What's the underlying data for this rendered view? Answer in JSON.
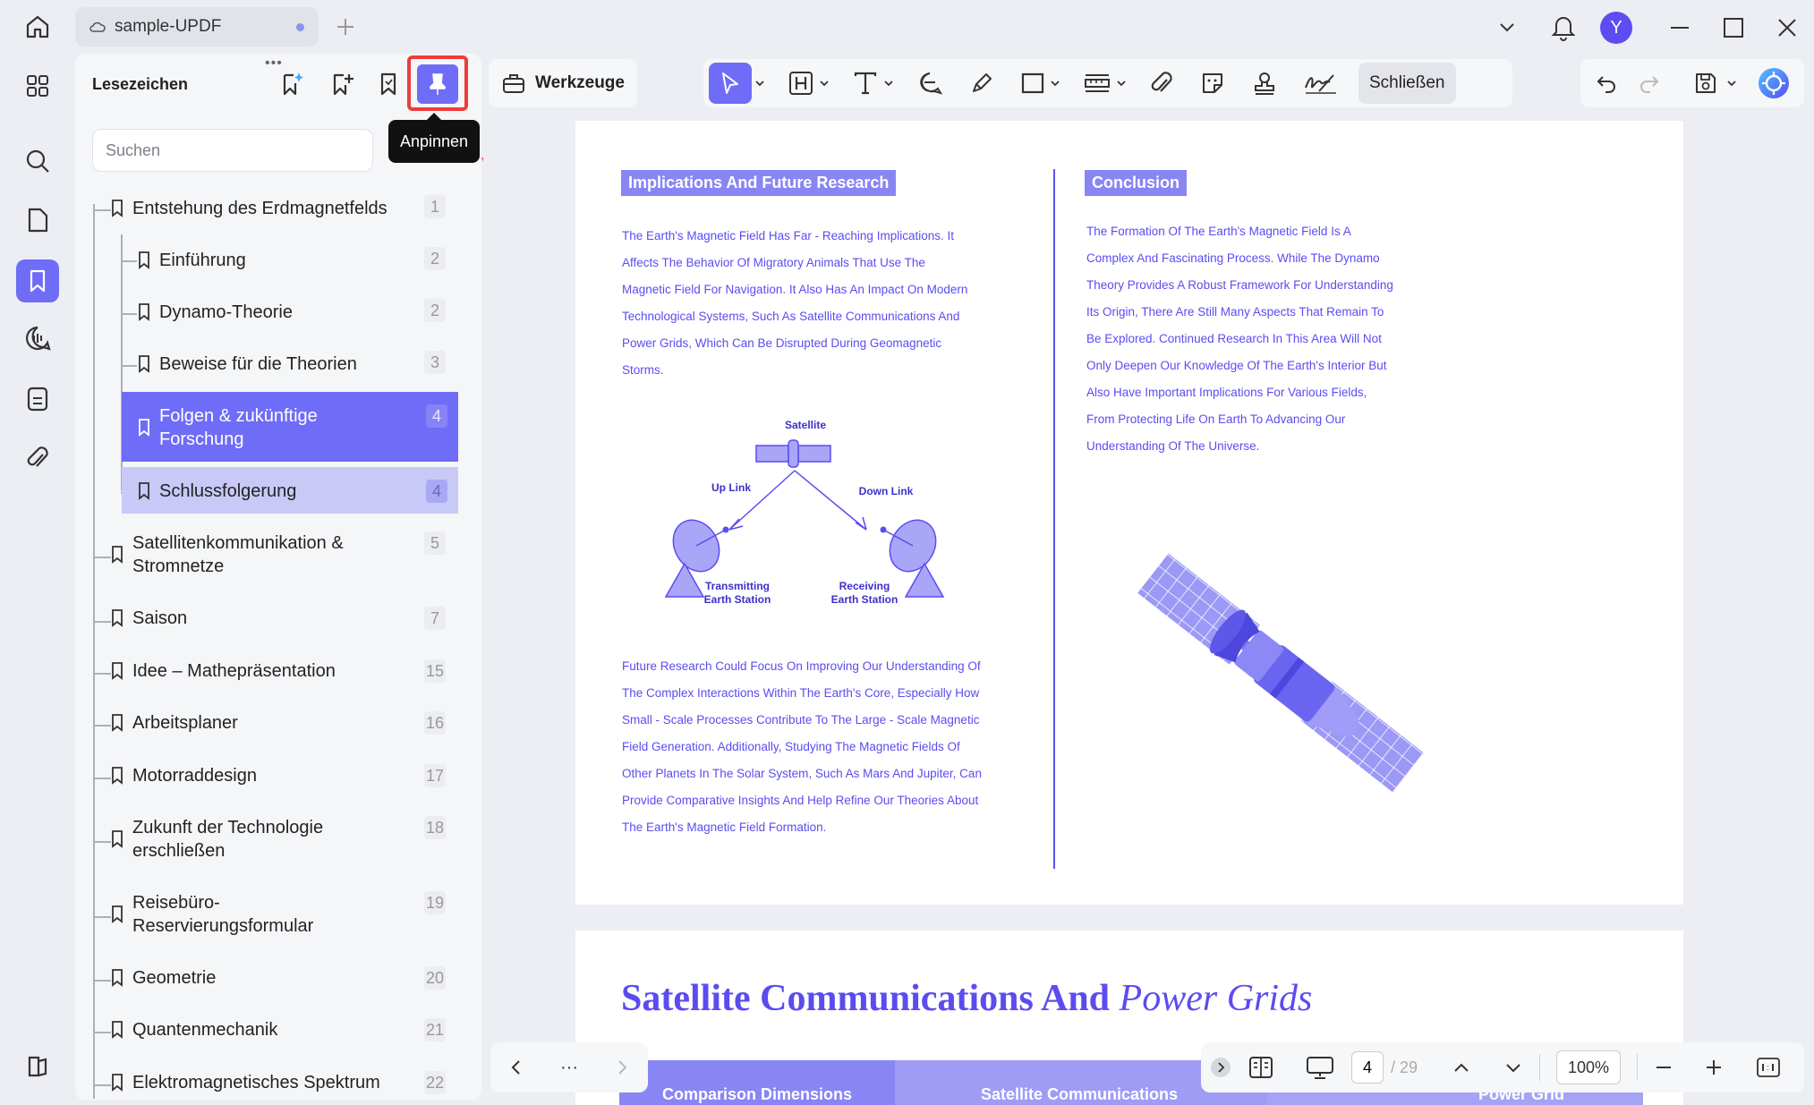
{
  "window": {
    "tab_title": "sample-UPDF",
    "avatar_letter": "Y"
  },
  "panel": {
    "title": "Lesezeichen",
    "pin_tooltip": "Anpinnen",
    "search_placeholder": "Suchen",
    "bookmarks": [
      {
        "label": "Entstehung des Erdmagnetfelds",
        "page": "1",
        "level": 0
      },
      {
        "label": "Einführung",
        "page": "2",
        "level": 1
      },
      {
        "label": "Dynamo-Theorie",
        "page": "2",
        "level": 1
      },
      {
        "label": "Beweise für die Theorien",
        "page": "3",
        "level": 1
      },
      {
        "label": "Folgen & zukünftige Forschung",
        "page": "4",
        "level": 1,
        "state": "selected"
      },
      {
        "label": "Schlussfolgerung",
        "page": "4",
        "level": 1,
        "state": "highlighted"
      },
      {
        "label": "Satellitenkommunikation & Stromnetze",
        "page": "5",
        "level": 0
      },
      {
        "label": "Saison",
        "page": "7",
        "level": 0
      },
      {
        "label": "Idee – Mathepräsentation",
        "page": "15",
        "level": 0
      },
      {
        "label": "Arbeitsplaner",
        "page": "16",
        "level": 0
      },
      {
        "label": "Motorraddesign",
        "page": "17",
        "level": 0
      },
      {
        "label": "Zukunft der Technologie erschließen",
        "page": "18",
        "level": 0
      },
      {
        "label": "Reisebüro-Reservierungsformular",
        "page": "19",
        "level": 0
      },
      {
        "label": "Geometrie",
        "page": "20",
        "level": 0
      },
      {
        "label": "Quantenmechanik",
        "page": "21",
        "level": 0
      },
      {
        "label": "Elektromagnetisches Spektrum",
        "page": "22",
        "level": 0
      }
    ]
  },
  "toolbar": {
    "tools_label": "Werkzeuge",
    "close_label": "Schließen"
  },
  "document": {
    "left_heading": "Implications And Future Research",
    "left_para_1": [
      "The Earth's Magnetic Field Has Far - Reaching Implications. It",
      "Affects The Behavior Of Migratory Animals That Use The",
      "Magnetic Field For Navigation. It Also Has An Impact On Modern",
      "Technological Systems, Such As Satellite Communications And",
      "Power Grids, Which Can Be Disrupted During Geomagnetic",
      "Storms."
    ],
    "diagram": {
      "satellite": "Satellite",
      "up_link": "Up Link",
      "down_link": "Down Link",
      "transmitting_1": "Transmitting",
      "transmitting_2": "Earth Station",
      "receiving_1": "Receiving",
      "receiving_2": "Earth Station"
    },
    "left_para_2": [
      "Future Research Could Focus On Improving Our Understanding Of",
      "The Complex Interactions Within The Earth's Core, Especially How",
      "Small - Scale Processes Contribute To The Large - Scale Magnetic",
      "Field Generation. Additionally, Studying The Magnetic Fields Of",
      "Other Planets In The Solar System, Such As Mars And Jupiter, Can",
      "Provide Comparative Insights And Help Refine Our Theories About",
      "The Earth's Magnetic Field Formation."
    ],
    "right_heading": "Conclusion",
    "right_para": [
      "The Formation Of The Earth's Magnetic Field Is A",
      "Complex And Fascinating Process. While The Dynamo",
      "Theory Provides A Robust Framework For Understanding",
      "Its Origin, There Are Still Many Aspects That Remain To",
      "Be Explored. Continued Research In This Area Will Not",
      "Only Deepen Our Knowledge Of The Earth's Interior But",
      "Also Have Important Implications For Various Fields,",
      "From Protecting Life On Earth To Advancing Our",
      "Understanding Of The Universe."
    ],
    "page2_title_bold": "Satellite Communications And",
    "page2_title_italic": "Power Grids",
    "page2_table_headers": [
      "Comparison Dimensions",
      "Satellite Communications",
      "Power Grid"
    ]
  },
  "navigation": {
    "more": "···",
    "current_page": "4",
    "total_pages": "/ 29",
    "zoom": "100%"
  },
  "colors": {
    "accent": "#6f6cf7",
    "doc_text": "#5b4cf0",
    "highlight_red": "#ee3b3b"
  }
}
